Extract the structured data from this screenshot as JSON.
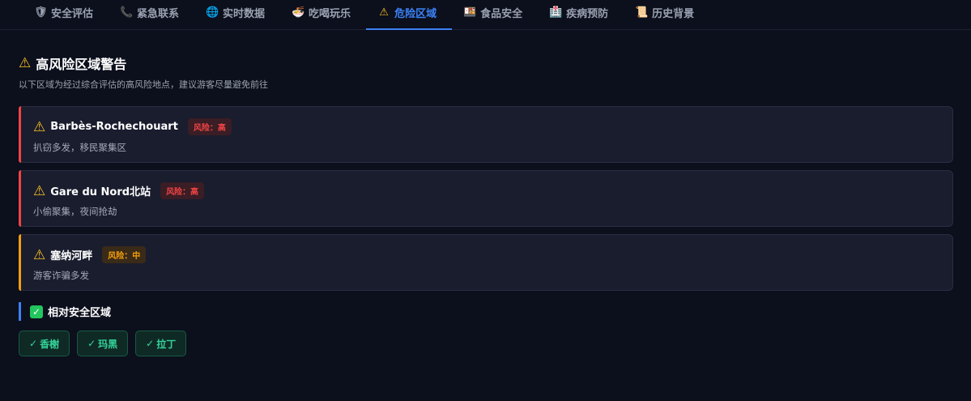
{
  "tabs": [
    {
      "icon": "🛡",
      "label": "安全评估"
    },
    {
      "icon": "📞",
      "label": "紧急联系"
    },
    {
      "icon": "🌐",
      "label": "实时数据"
    },
    {
      "icon": "🍜",
      "label": "吃喝玩乐"
    },
    {
      "icon": "⚠",
      "label": "危险区域"
    },
    {
      "icon": "🍱",
      "label": "食品安全"
    },
    {
      "icon": "🏥",
      "label": "疾病预防"
    },
    {
      "icon": "📜",
      "label": "历史背景"
    }
  ],
  "active_tab": "危险区域",
  "warning": {
    "icon": "⚠",
    "title": "高风险区域警告",
    "subtitle": "以下区域为经过综合评估的高风险地点，建议游客尽量避免前往"
  },
  "zones": [
    {
      "icon": "⚠",
      "name": "Barbès-Rochechouart",
      "risk": "风险：高",
      "level": "high",
      "description": "扒窃多发，移民聚集区"
    },
    {
      "icon": "⚠",
      "name": "Gare du Nord北站",
      "risk": "风险：高",
      "level": "high",
      "description": "小偷聚集，夜间抢劫"
    },
    {
      "icon": "⚠",
      "name": "塞纳河畔",
      "risk": "风险：中",
      "level": "mid",
      "description": "游客诈骗多发"
    }
  ],
  "safe": {
    "icon": "✓",
    "title": "相对安全区域",
    "areas": [
      {
        "check": "✓",
        "label": "香榭"
      },
      {
        "check": "✓",
        "label": "玛黑"
      },
      {
        "check": "✓",
        "label": "拉丁"
      }
    ]
  },
  "colors": {
    "background": "#0c0f1c",
    "accent": "#3b82f6",
    "risk_high": "#ef4444",
    "risk_mid": "#f59e0b",
    "safe": "#34d399"
  }
}
